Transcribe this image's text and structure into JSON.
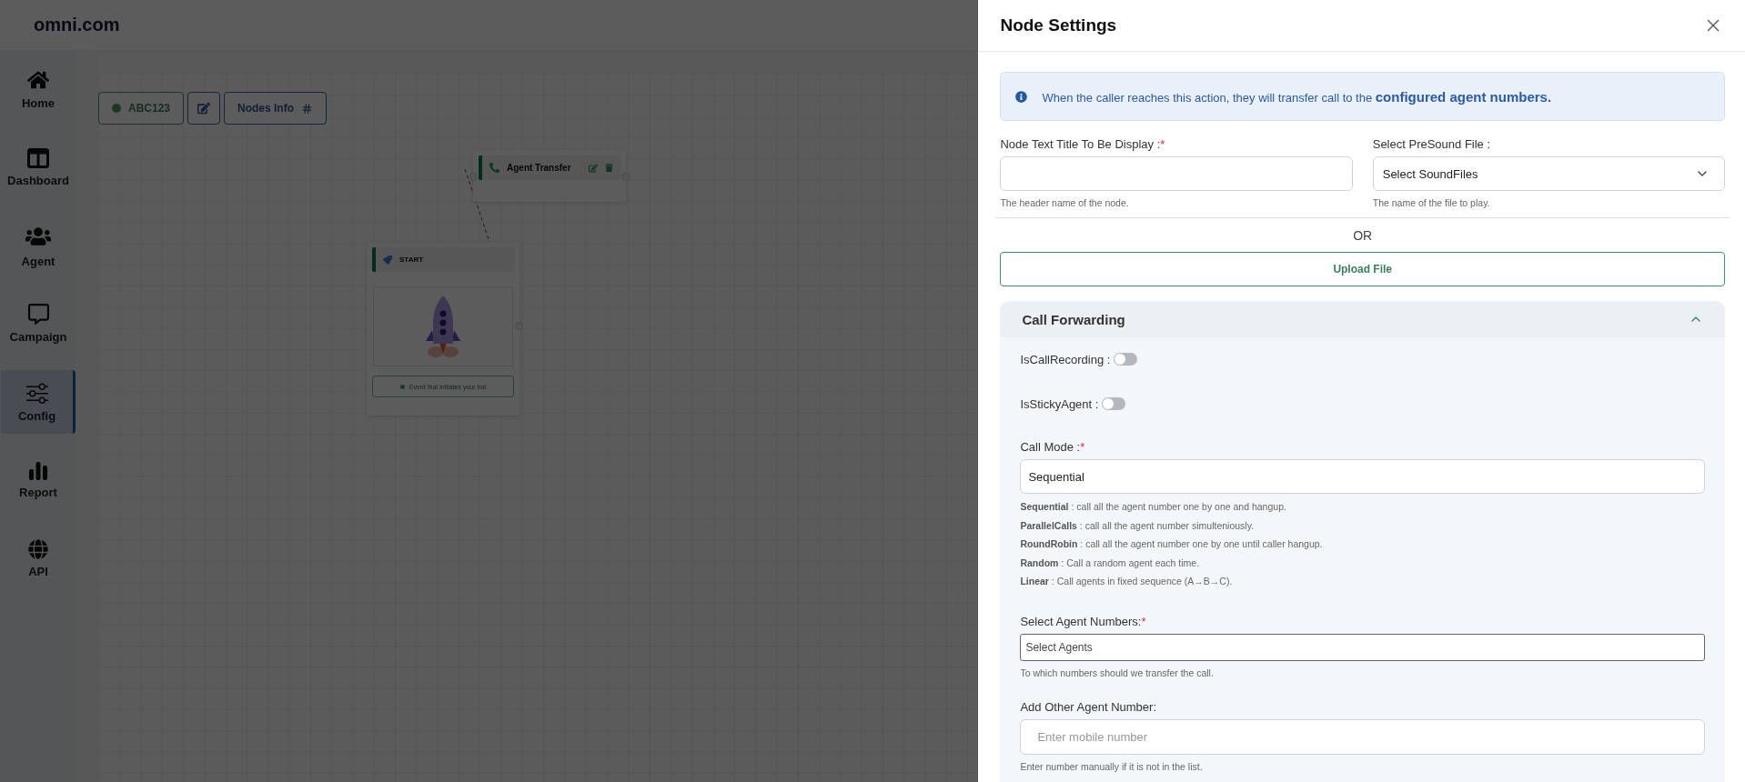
{
  "app": {
    "brand": "omni.com"
  },
  "sidebar": {
    "items": [
      {
        "label": "Home",
        "selected": false
      },
      {
        "label": "Dashboard",
        "selected": false
      },
      {
        "label": "Agent",
        "selected": false
      },
      {
        "label": "Campaign",
        "selected": false
      },
      {
        "label": "Config",
        "selected": true
      },
      {
        "label": "Report",
        "selected": false
      },
      {
        "label": "API",
        "selected": false
      }
    ]
  },
  "canvas": {
    "toolbar": {
      "flow_name": "ABC123",
      "nodes_info": "Nodes Info"
    },
    "nodes": [
      {
        "kind": "action",
        "title": "Agent Transfer"
      },
      {
        "kind": "start",
        "title": "START",
        "caption": "Event that initiates your bot"
      }
    ]
  },
  "panel": {
    "title": "Node Settings",
    "info": "When the caller reaches this action, they will transfer call to the **configured agent numbers.**",
    "fields": [
      {
        "kind": "text",
        "label": "Node Text Title To Be Display :",
        "required_mark": "*",
        "hint": "The header name of the node."
      },
      {
        "kind": "select",
        "label": "Select PreSound File :",
        "value": "Select SoundFiles",
        "hint": "The name of the file to play."
      }
    ],
    "or_text": "OR",
    "upload_button": "Upload File",
    "section": {
      "title": "Call Forwarding",
      "expanded": true,
      "toggles": [
        {
          "label": "IsCallRecording :",
          "on": false
        },
        {
          "label": "IsStickyAgent :",
          "on": false
        }
      ],
      "call_mode": {
        "label": "Call Mode :",
        "required_mark": "*",
        "value": "Sequential",
        "descriptions": [
          "**Sequential** : call all the agent number one by one and hangup.",
          "**ParallelCalls** : call all the agent number simulteniously.",
          "**RoundRobin** : call all the agent number one by one until caller hangup.",
          "**Random** : Call a random agent each time.",
          "**Linear** : Call agents in fixed sequence (A→B→C)."
        ]
      },
      "agents": {
        "label": "Select Agent Numbers:",
        "required_mark": "*",
        "placeholder": "Select Agents",
        "hint": "To which numbers should we transfer the call."
      },
      "other": {
        "label": "Add Other Agent Number:",
        "placeholder": "Enter mobile number",
        "hint": "Enter number manually if it is not in the list."
      }
    }
  }
}
